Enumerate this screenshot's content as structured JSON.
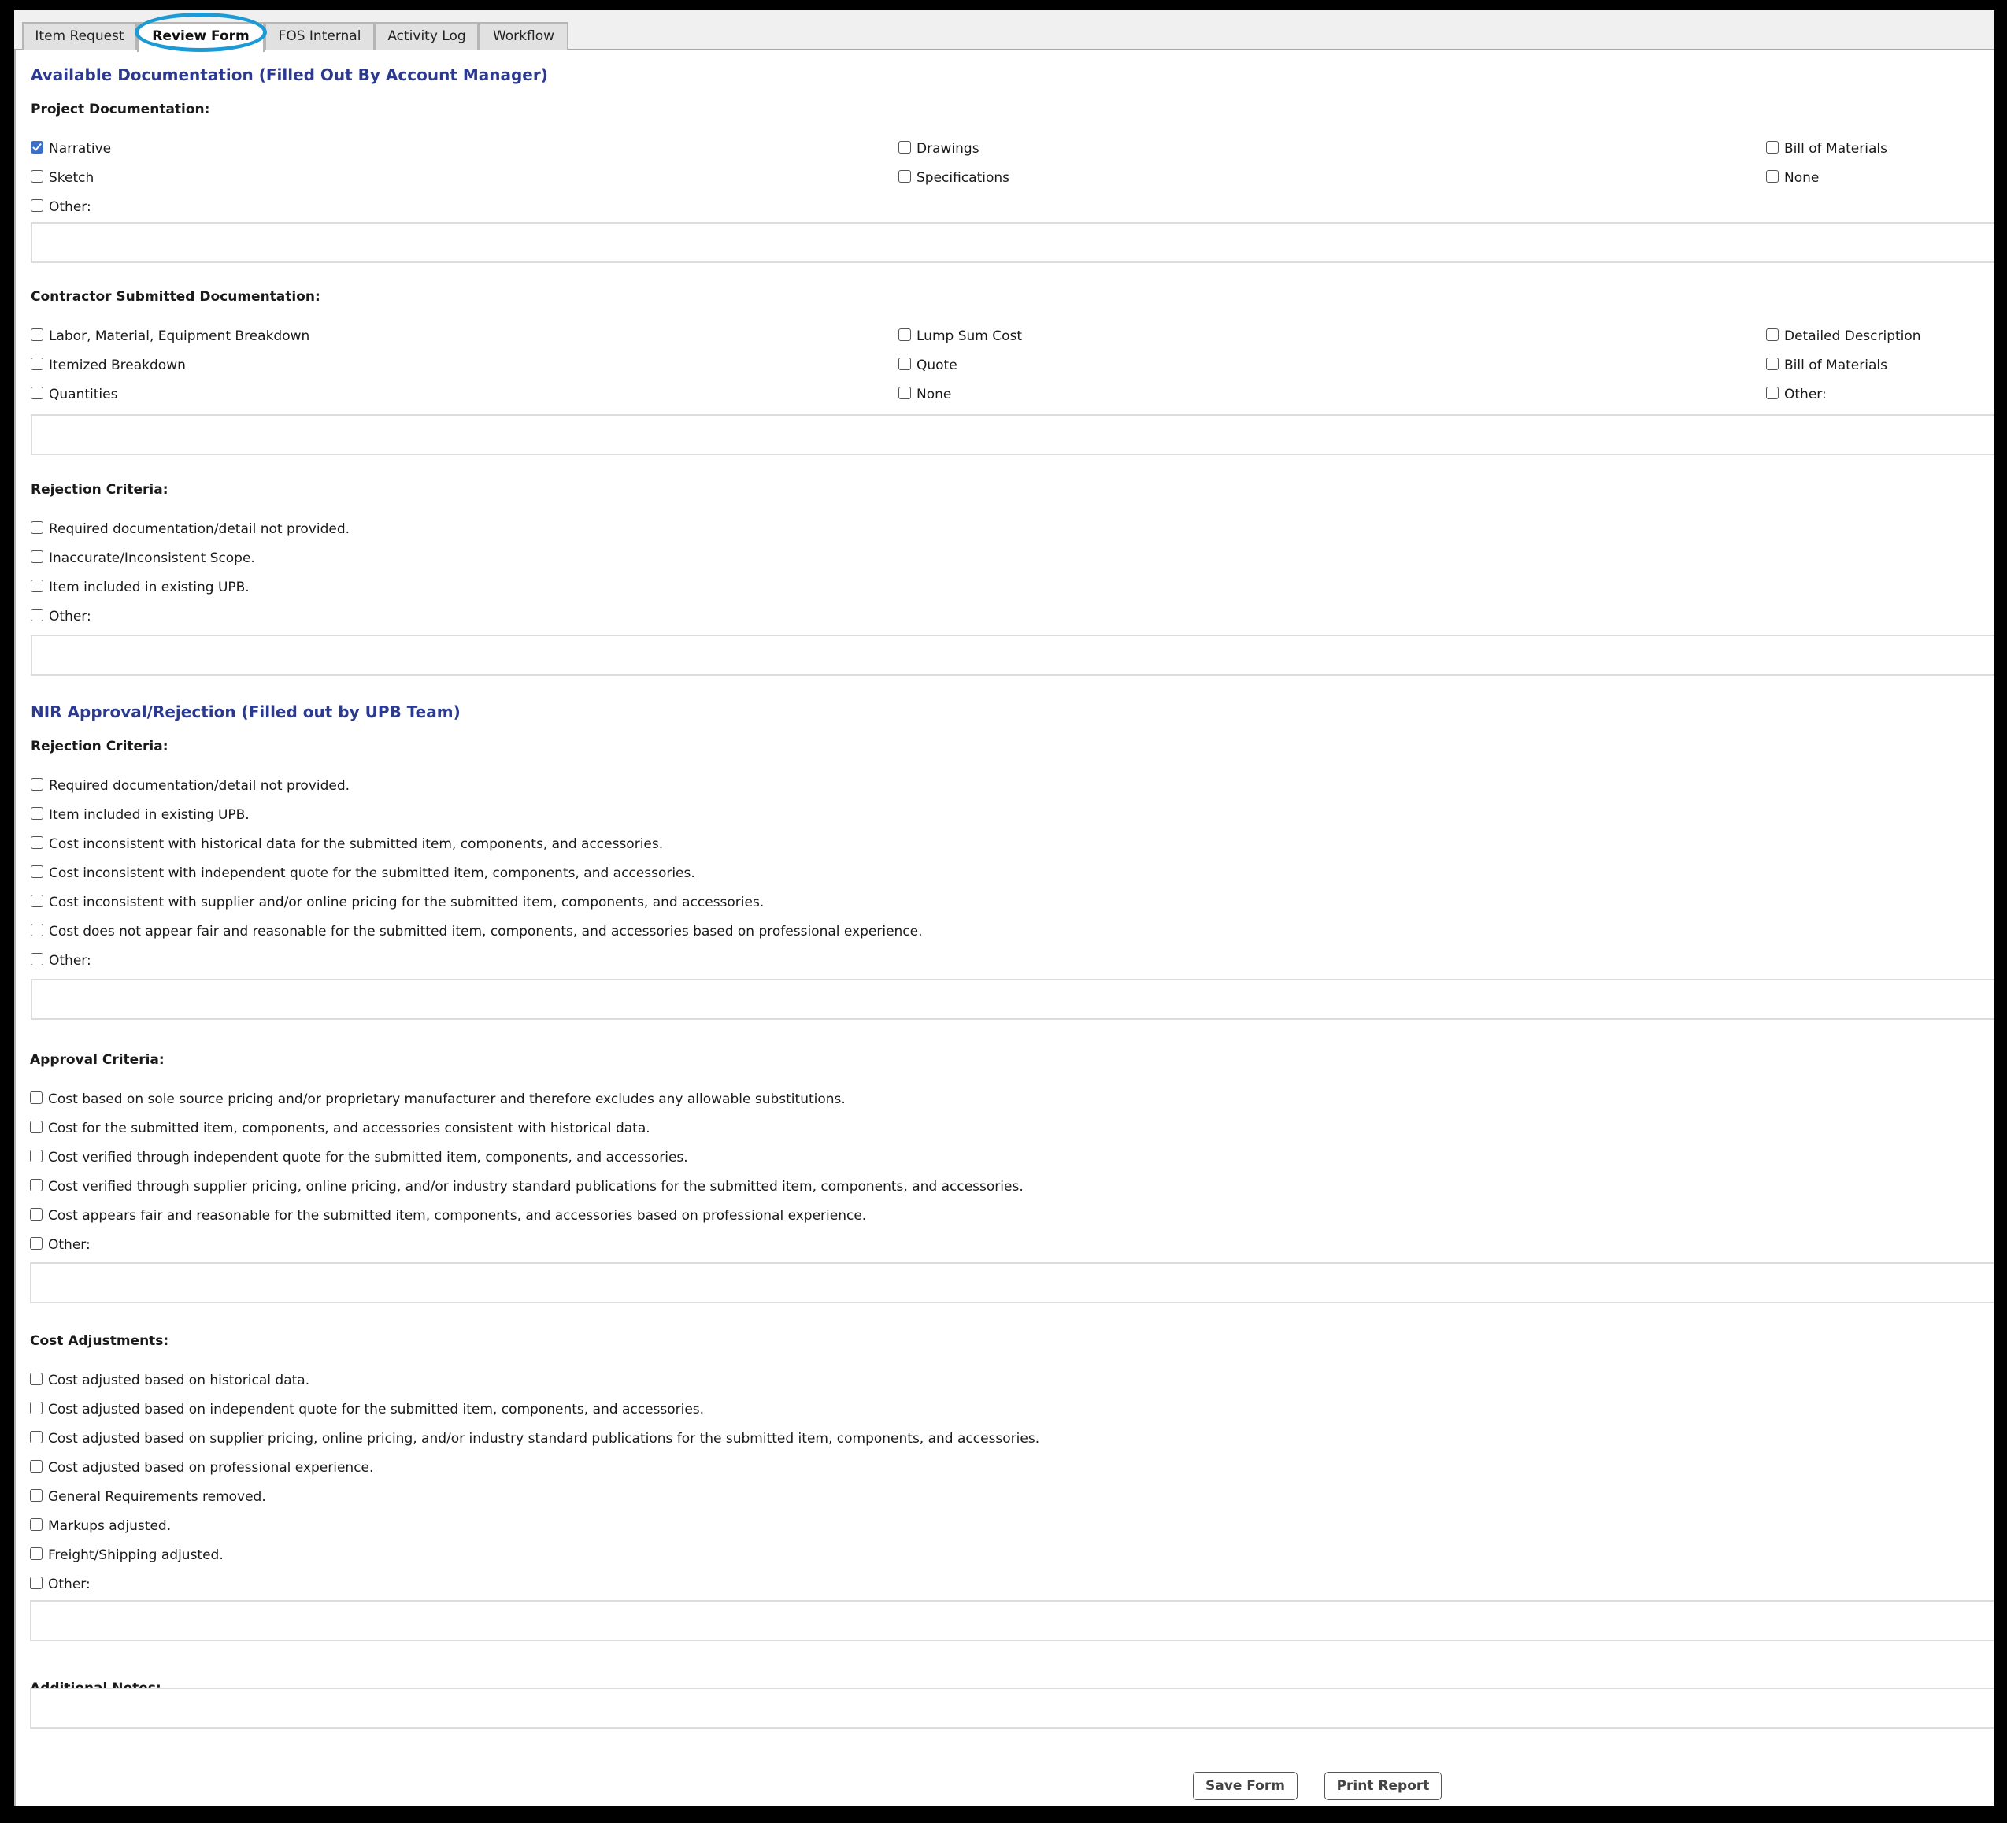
{
  "tabs": [
    {
      "label": "Item Request",
      "active": false
    },
    {
      "label": "Review Form",
      "active": true
    },
    {
      "label": "FOS Internal",
      "active": false
    },
    {
      "label": "Activity Log",
      "active": false
    },
    {
      "label": "Workflow",
      "active": false
    }
  ],
  "section_available": {
    "title": "Available Documentation (Filled Out By Account Manager)",
    "project_documentation": {
      "label": "Project Documentation:",
      "options": [
        {
          "label": "Narrative",
          "checked": true
        },
        {
          "label": "Drawings",
          "checked": false
        },
        {
          "label": "Bill of Materials",
          "checked": false
        },
        {
          "label": "Sketch",
          "checked": false
        },
        {
          "label": "Specifications",
          "checked": false
        },
        {
          "label": "None",
          "checked": false
        },
        {
          "label": "Other:",
          "checked": false
        }
      ],
      "other_text": ""
    },
    "contractor_documentation": {
      "label": "Contractor Submitted Documentation:",
      "options": [
        {
          "label": "Labor, Material, Equipment Breakdown",
          "checked": false
        },
        {
          "label": "Lump Sum Cost",
          "checked": false
        },
        {
          "label": "Detailed Description",
          "checked": false
        },
        {
          "label": "Itemized Breakdown",
          "checked": false
        },
        {
          "label": "Quote",
          "checked": false
        },
        {
          "label": "Bill of Materials",
          "checked": false
        },
        {
          "label": "Quantities",
          "checked": false
        },
        {
          "label": "None",
          "checked": false
        },
        {
          "label": "Other:",
          "checked": false
        }
      ],
      "other_text": ""
    },
    "rejection_criteria": {
      "label": "Rejection Criteria:",
      "options": [
        {
          "label": "Required documentation/detail not provided.",
          "checked": false
        },
        {
          "label": "Inaccurate/Inconsistent Scope.",
          "checked": false
        },
        {
          "label": "Item included in existing UPB.",
          "checked": false
        },
        {
          "label": "Other:",
          "checked": false
        }
      ],
      "other_text": ""
    }
  },
  "section_nir": {
    "title": "NIR Approval/Rejection (Filled out by UPB Team)",
    "rejection_criteria": {
      "label": "Rejection Criteria:",
      "options": [
        {
          "label": "Required documentation/detail not provided.",
          "checked": false
        },
        {
          "label": "Item included in existing UPB.",
          "checked": false
        },
        {
          "label": "Cost inconsistent with historical data for the submitted item, components, and accessories.",
          "checked": false
        },
        {
          "label": "Cost inconsistent with independent quote for the submitted item, components, and accessories.",
          "checked": false
        },
        {
          "label": "Cost inconsistent with supplier and/or online pricing for the submitted item, components, and accessories.",
          "checked": false
        },
        {
          "label": "Cost does not appear fair and reasonable for the submitted item, components, and accessories based on professional experience.",
          "checked": false
        },
        {
          "label": "Other:",
          "checked": false
        }
      ],
      "other_text": ""
    },
    "approval_criteria": {
      "label": "Approval Criteria:",
      "options": [
        {
          "label": "Cost based on sole source pricing and/or proprietary manufacturer and therefore excludes any allowable substitutions.",
          "checked": false
        },
        {
          "label": "Cost for the submitted item, components, and accessories consistent with historical data.",
          "checked": false
        },
        {
          "label": "Cost verified through independent quote for the submitted item, components, and accessories.",
          "checked": false
        },
        {
          "label": "Cost verified through supplier pricing, online pricing, and/or industry standard publications for the submitted item, components, and accessories.",
          "checked": false
        },
        {
          "label": "Cost appears fair and reasonable for the submitted item, components, and accessories based on professional experience.",
          "checked": false
        },
        {
          "label": "Other:",
          "checked": false
        }
      ],
      "other_text": ""
    },
    "cost_adjustments": {
      "label": "Cost Adjustments:",
      "options": [
        {
          "label": "Cost adjusted based on historical data.",
          "checked": false
        },
        {
          "label": "Cost adjusted based on independent quote for the submitted item, components, and accessories.",
          "checked": false
        },
        {
          "label": "Cost adjusted based on supplier pricing, online pricing, and/or industry standard publications for the submitted item, components, and accessories.",
          "checked": false
        },
        {
          "label": "Cost adjusted based on professional experience.",
          "checked": false
        },
        {
          "label": "General Requirements removed.",
          "checked": false
        },
        {
          "label": "Markups adjusted.",
          "checked": false
        },
        {
          "label": "Freight/Shipping adjusted.",
          "checked": false
        },
        {
          "label": "Other:",
          "checked": false
        }
      ],
      "other_text": ""
    },
    "additional_notes": {
      "label": "Additional Notes:",
      "text": ""
    }
  },
  "buttons": {
    "save": "Save Form",
    "print": "Print Report"
  },
  "colors": {
    "section_title": "#2b3a8f",
    "tab_highlight": "#1b9ad6",
    "checkbox_checked": "#3b6fc9"
  }
}
